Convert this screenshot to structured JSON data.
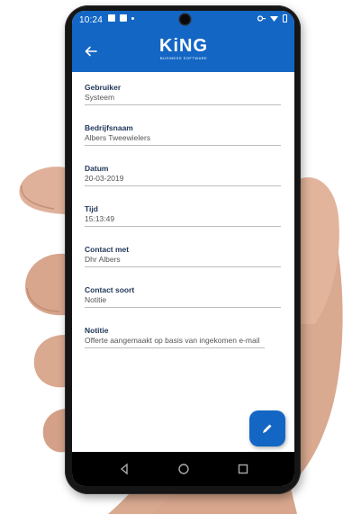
{
  "statusbar": {
    "time": "10:24"
  },
  "appbar": {
    "back_icon": "arrow-left-icon",
    "logo_text": "KiNG",
    "logo_subtext": "BUSINESS SOFTWARE"
  },
  "fields": [
    {
      "label": "Gebruiker",
      "value": "Systeem"
    },
    {
      "label": "Bedrijfsnaam",
      "value": "Albers Tweewielers"
    },
    {
      "label": "Datum",
      "value": "20-03-2019"
    },
    {
      "label": "Tijd",
      "value": "15:13:49"
    },
    {
      "label": "Contact met",
      "value": "Dhr Albers"
    },
    {
      "label": "Contact soort",
      "value": "Notitie"
    },
    {
      "label": "Notitie",
      "value": "Offerte aangemaakt op basis van ingekomen e-mail"
    }
  ],
  "fab": {
    "icon": "pencil-icon"
  },
  "navbar": {
    "back": "triangle-back-icon",
    "home": "circle-home-icon",
    "recents": "square-recents-icon"
  },
  "colors": {
    "primary": "#1366c4",
    "label": "#1f3557"
  }
}
